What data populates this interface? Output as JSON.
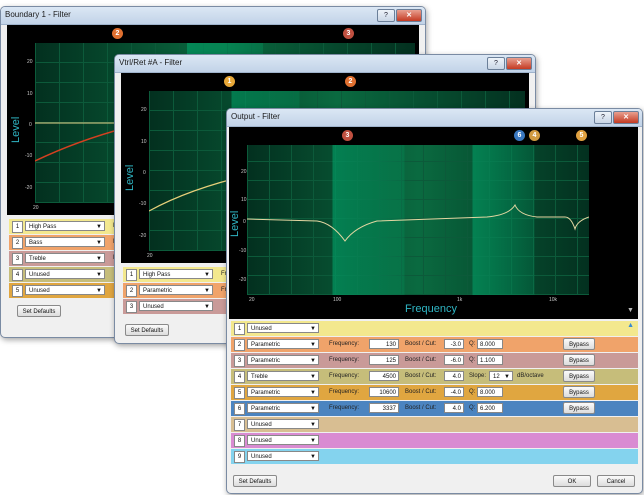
{
  "windows": [
    {
      "title": "Boundary 1 - Filter",
      "markers": [
        "2",
        "3"
      ],
      "y_axis_label": "Level",
      "y_ticks": [
        "20",
        "10",
        "0",
        "-10",
        "-20"
      ],
      "bands": [
        {
          "num": "1",
          "type": "High Pass",
          "cut": "Fr"
        },
        {
          "num": "2",
          "type": "Bass",
          "cut": "Fr"
        },
        {
          "num": "3",
          "type": "Treble",
          "cut": "Fr"
        },
        {
          "num": "4",
          "type": "Unused",
          "cut": ""
        },
        {
          "num": "5",
          "type": "Unused",
          "cut": ""
        }
      ],
      "set_defaults": "Set Defaults",
      "x_tick_partial": "20"
    },
    {
      "title": "Vtrl/Ret #A - Filter",
      "markers": [
        "1",
        "2"
      ],
      "y_axis_label": "Level",
      "y_ticks": [
        "20",
        "10",
        "0",
        "-10",
        "-20"
      ],
      "bands": [
        {
          "num": "1",
          "type": "High Pass",
          "cut": "Fr"
        },
        {
          "num": "2",
          "type": "Parametric",
          "cut": "Fr"
        },
        {
          "num": "3",
          "type": "Unused",
          "cut": ""
        }
      ],
      "set_defaults": "Set Defaults",
      "x_tick_partial": "20"
    },
    {
      "title": "Output - Filter",
      "markers": [
        "3",
        "6",
        "4",
        "5"
      ],
      "y_axis_label": "Level",
      "x_axis_label": "Frequency",
      "y_ticks": [
        "20",
        "10",
        "0",
        "-10",
        "-20"
      ],
      "x_ticks": [
        "20",
        "100",
        "1k",
        "10k"
      ],
      "labels": {
        "frequency": "Frequency:",
        "boost": "Boost / Cut:",
        "q": "Q:",
        "slope": "Slope:",
        "db_oct": "dB/octave",
        "bypass": "Bypass"
      },
      "bands": [
        {
          "num": "1",
          "type": "Unused"
        },
        {
          "num": "2",
          "type": "Parametric",
          "freq": "130",
          "boost": "-3.0",
          "q": "8.000"
        },
        {
          "num": "3",
          "type": "Parametric",
          "freq": "125",
          "boost": "-6.0",
          "q": "1.100"
        },
        {
          "num": "4",
          "type": "Treble",
          "freq": "4500",
          "boost": "4.0",
          "slope": "12"
        },
        {
          "num": "5",
          "type": "Parametric",
          "freq": "10600",
          "boost": "-4.0",
          "q": "8.000"
        },
        {
          "num": "6",
          "type": "Parametric",
          "freq": "3337",
          "boost": "4.0",
          "q": "6.200"
        },
        {
          "num": "7",
          "type": "Unused"
        },
        {
          "num": "8",
          "type": "Unused"
        },
        {
          "num": "9",
          "type": "Unused"
        }
      ],
      "set_defaults": "Set Defaults",
      "ok": "OK",
      "cancel": "Cancel"
    }
  ],
  "colors": {
    "band1": "#f3e88e",
    "band2": "#f0a36a",
    "band3": "#c99a98",
    "band4": "#c6bd7a",
    "band5": "#e0a640",
    "band6": "#4b84c0",
    "band7": "#d8be92",
    "band8": "#d98bd2",
    "band9": "#84d3ee",
    "marker1": "#e8a838",
    "marker2": "#e07030",
    "marker3": "#c05040",
    "marker4": "#d09a40",
    "marker5": "#e0a040",
    "marker6": "#3a78c0"
  }
}
